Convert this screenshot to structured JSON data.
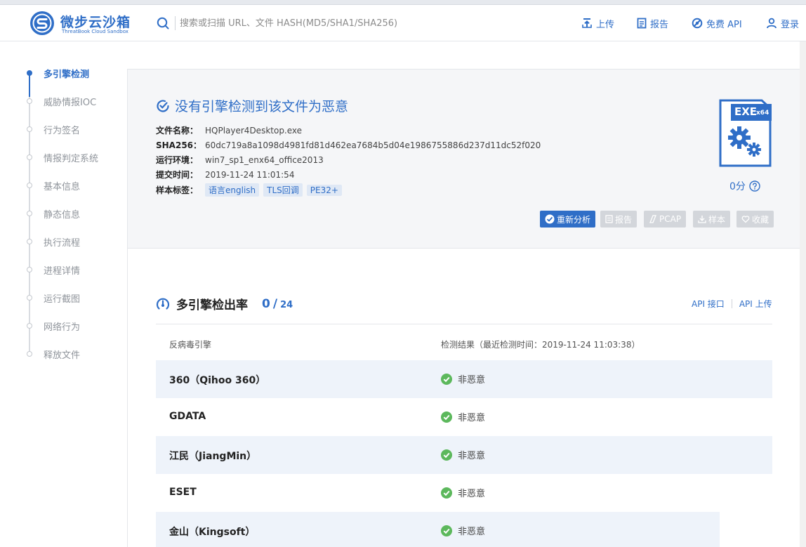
{
  "header": {
    "logo_cn": "微步云沙箱",
    "logo_en": "ThreatBook Cloud Sandbox",
    "search_placeholder": "搜索或扫描 URL、文件 HASH(MD5/SHA1/SHA256)",
    "nav": {
      "upload": "上传",
      "report": "报告",
      "free_api": "免费 API",
      "login": "登录"
    }
  },
  "sidebar": {
    "items": [
      {
        "label": "多引擎检测",
        "active": true
      },
      {
        "label": "威胁情报IOC"
      },
      {
        "label": "行为签名"
      },
      {
        "label": "情报判定系统"
      },
      {
        "label": "基本信息"
      },
      {
        "label": "静态信息"
      },
      {
        "label": "执行流程"
      },
      {
        "label": "进程详情"
      },
      {
        "label": "运行截图"
      },
      {
        "label": "网络行为"
      },
      {
        "label": "释放文件"
      }
    ]
  },
  "summary": {
    "title": "没有引擎检测到该文件为恶意",
    "fields": {
      "filename_label": "文件名称：",
      "filename": "HQPlayer4Desktop.exe",
      "sha256_label": "SHA256：",
      "sha256": "60dc719a8a1098d4981fd81d462ea7684b5d04e1986755886d237d11dc52f020",
      "env_label": "运行环境：",
      "env": "win7_sp1_enx64_office2013",
      "time_label": "提交时间：",
      "time": "2019-11-24 11:01:54",
      "tags_label": "样本标签："
    },
    "tags": [
      "语言english",
      "TLS回调",
      "PE32+"
    ],
    "file_type": "EXE",
    "file_arch": "x64",
    "score": "0分",
    "buttons": {
      "reanalyze": "重新分析",
      "report": "报告",
      "pcap": "PCAP",
      "sample": "样本",
      "favorite": "收藏"
    }
  },
  "engines": {
    "title": "多引擎检出率",
    "detected": "0",
    "separator": "/",
    "total": "24",
    "api_interface": "API 接口",
    "api_upload": "API 上传",
    "col_engine": "反病毒引擎",
    "col_result": "检测结果（最近检测时间：2019-11-24 11:03:38）",
    "rows": [
      {
        "engine": "360（Qihoo 360）",
        "result": "非恶意"
      },
      {
        "engine": "GDATA",
        "result": "非恶意"
      },
      {
        "engine": "江民（JiangMin）",
        "result": "非恶意"
      },
      {
        "engine": "ESET",
        "result": "非恶意"
      },
      {
        "engine": "金山（Kingsoft）",
        "result": "非恶意"
      }
    ]
  },
  "colors": {
    "accent": "#2f6ec7",
    "ok_green": "#5cb85c",
    "disabled": "#d3d6db"
  }
}
